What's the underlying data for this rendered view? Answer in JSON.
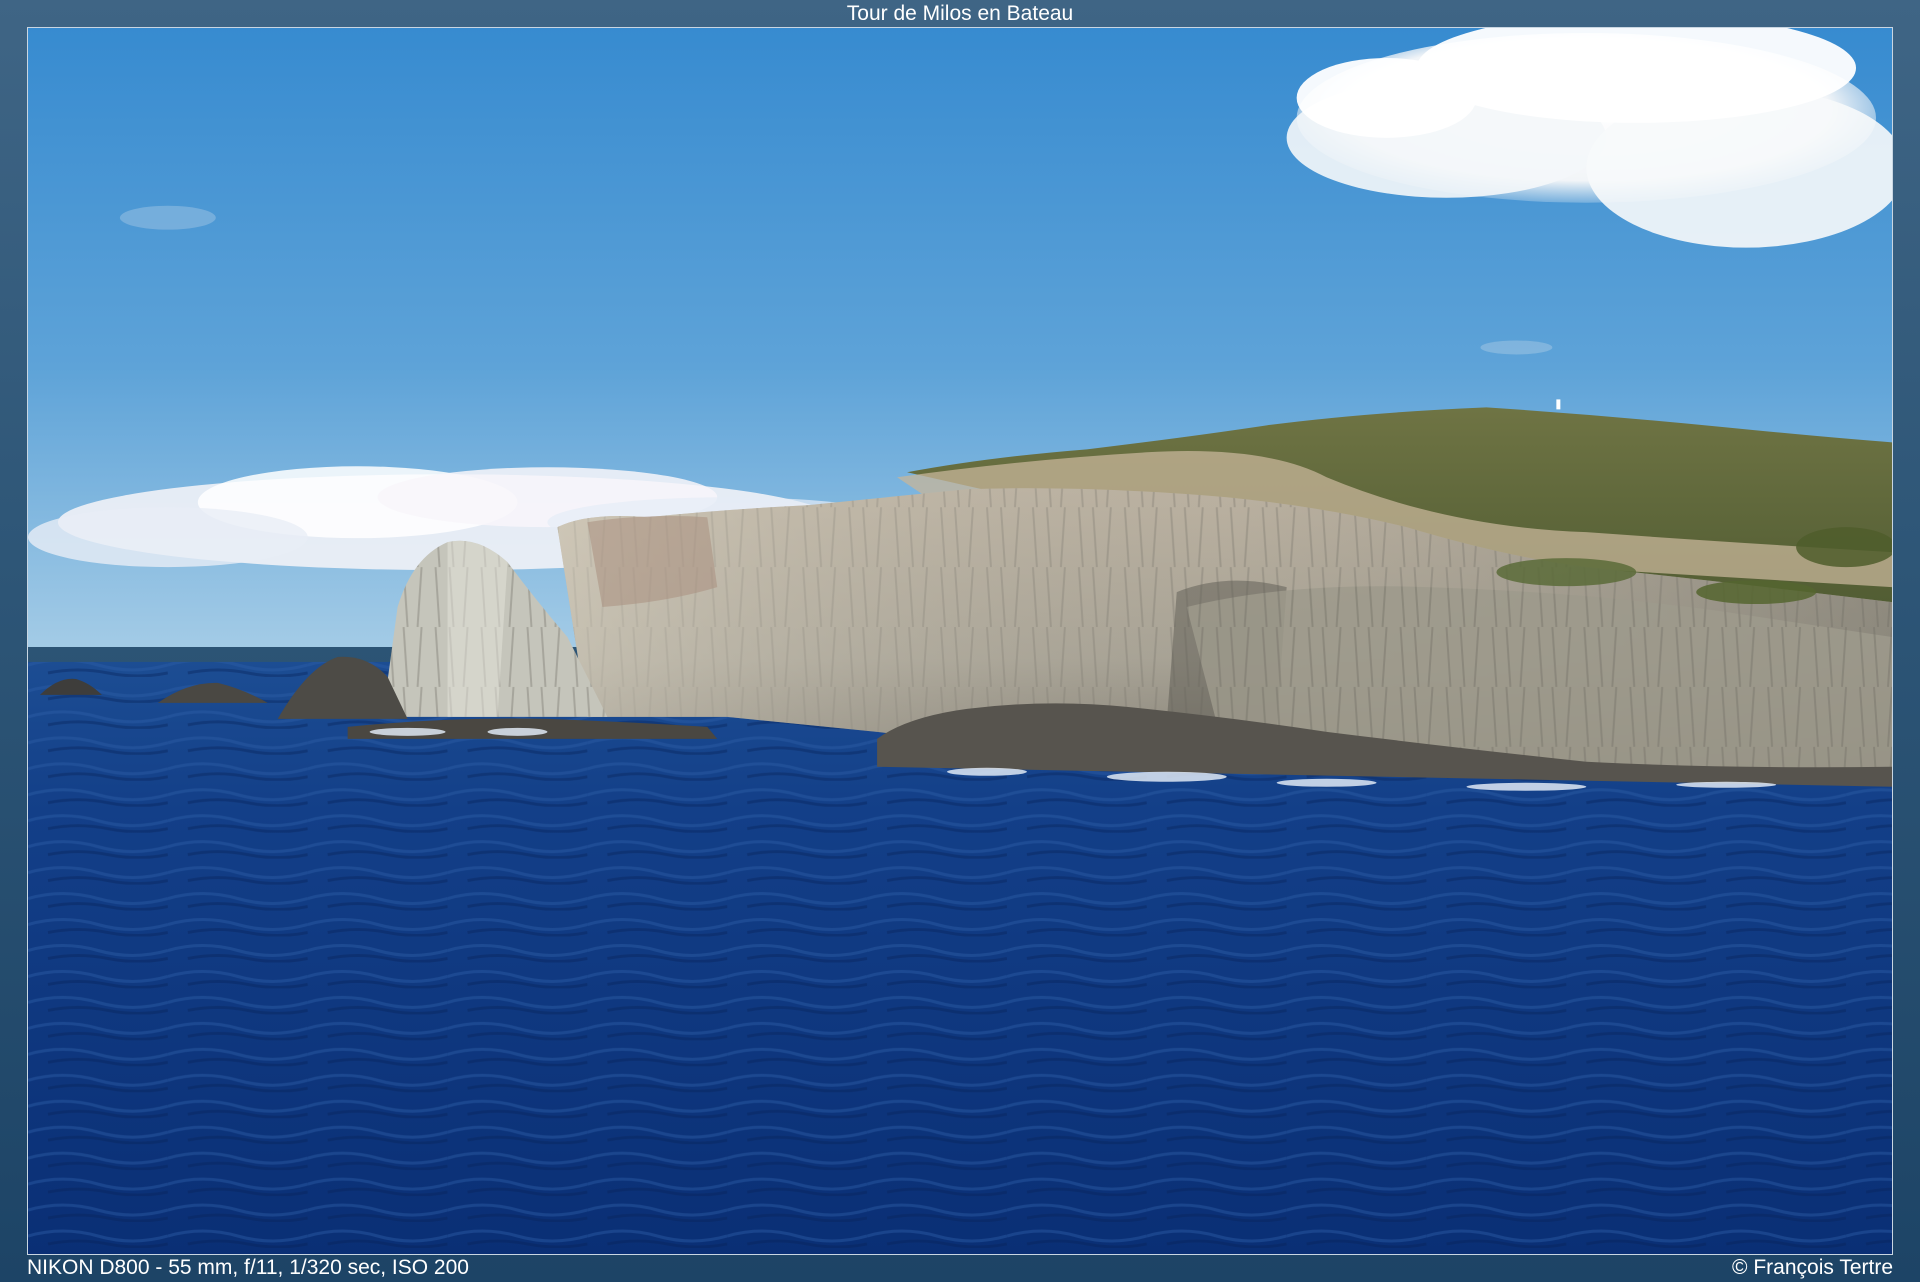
{
  "gallery": {
    "title": "Tour de Milos en Bateau",
    "exif": "NIKON D800 - 55 mm, f/11, 1/320 sec, ISO 200",
    "copyright": "© François Tertre"
  },
  "photo": {
    "subject": "seascape-coastal-cliffs",
    "colors": {
      "sky_top": "#3b8fd0",
      "sky_horizon": "#8fc0e2",
      "sea": "#0f3c86",
      "sea_deep": "#0a2b6a",
      "cliff": "#b7b1a3",
      "vegetation": "#5d6a3a"
    }
  }
}
